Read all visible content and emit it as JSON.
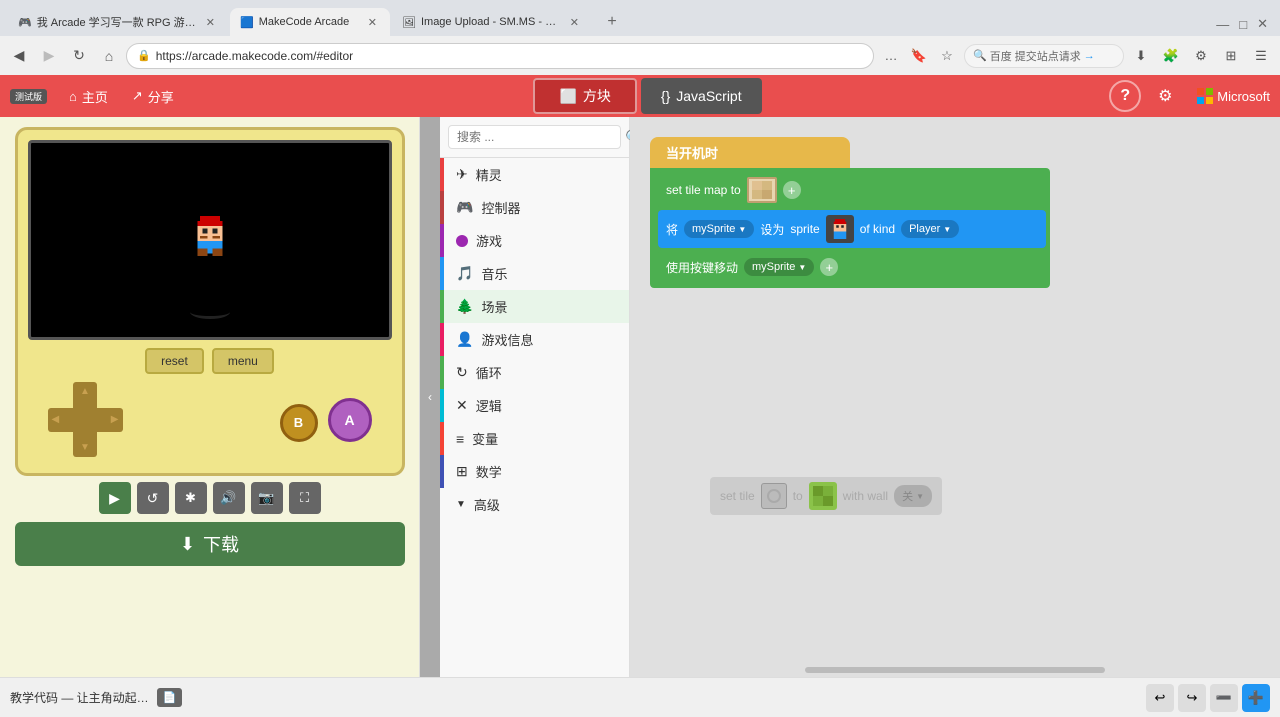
{
  "browser": {
    "tabs": [
      {
        "id": "tab1",
        "label": "我 Arcade 学习写一款 RPG 游戏 ...",
        "favicon": "🎮",
        "active": false
      },
      {
        "id": "tab2",
        "label": "MakeCode Arcade",
        "favicon": "🟦",
        "active": true
      },
      {
        "id": "tab3",
        "label": "Image Upload - SM.MS - Simp...",
        "favicon": "🖼",
        "active": false
      }
    ],
    "address": "https://arcade.makecode.com/#editor",
    "lock_icon": "🔒",
    "search_placeholder": "百度 提交站点请求"
  },
  "app": {
    "beta_label": "测试版",
    "home_label": "主页",
    "share_label": "分享",
    "mode_blocks_label": "方块",
    "mode_js_label": "JavaScript",
    "help_icon": "?",
    "settings_icon": "⚙",
    "microsoft_label": "Microsoft"
  },
  "simulator": {
    "reset_label": "reset",
    "menu_label": "menu",
    "download_label": "下载",
    "controls": [
      {
        "id": "play",
        "icon": "▶",
        "color": "green"
      },
      {
        "id": "restart",
        "icon": "↺",
        "color": "gray"
      },
      {
        "id": "slow",
        "icon": "⏱",
        "color": "gray"
      },
      {
        "id": "sound",
        "icon": "🔊",
        "color": "gray"
      },
      {
        "id": "screenshot",
        "icon": "📷",
        "color": "gray"
      },
      {
        "id": "fullscreen",
        "icon": "⛶",
        "color": "gray"
      }
    ]
  },
  "categories": [
    {
      "id": "sprites",
      "label": "精灵",
      "color": "#e94040",
      "icon": "✈"
    },
    {
      "id": "controller",
      "label": "控制器",
      "color": "#b94040",
      "icon": "🎮"
    },
    {
      "id": "game",
      "label": "游戏",
      "color": "#9c27b0",
      "icon": "⬤"
    },
    {
      "id": "music",
      "label": "音乐",
      "color": "#2196f3",
      "icon": "🎵"
    },
    {
      "id": "scene",
      "label": "场景",
      "color": "#4caf50",
      "icon": "🌲"
    },
    {
      "id": "info",
      "label": "游戏信息",
      "color": "#e91e63",
      "icon": "👤"
    },
    {
      "id": "loops",
      "label": "循环",
      "color": "#4caf50",
      "icon": "↻"
    },
    {
      "id": "logic",
      "label": "逻辑",
      "color": "#00bcd4",
      "icon": "✕"
    },
    {
      "id": "variables",
      "label": "变量",
      "color": "#f44336",
      "icon": "≡"
    },
    {
      "id": "math",
      "label": "数学",
      "color": "#3f51b5",
      "icon": "⊞"
    },
    {
      "id": "advanced",
      "label": "高级",
      "color": "#666",
      "icon": "▼"
    }
  ],
  "search_placeholder": "搜索 ...",
  "blocks": {
    "event_label": "当开机时",
    "set_tile_map_label": "set tile map to",
    "assign_label": "将",
    "mySprite_label": "mySprite",
    "set_label": "设为",
    "sprite_label": "sprite",
    "of_kind_label": "of kind",
    "player_label": "Player",
    "move_label": "使用按键移动",
    "set_tile_label": "set tile",
    "to_label": "to",
    "with_wall_label": "with wall",
    "wall_label": "关"
  },
  "bottom_bar": {
    "tutorial_label": "教学代码 — 让主角动起…",
    "doc_icon": "📄"
  },
  "colors": {
    "event": "#e7b84a",
    "green_block": "#4caf50",
    "blue_block": "#2196f3",
    "red_block": "#e94e4e",
    "toolbar": "#e94e4e",
    "download": "#4a7f4a"
  }
}
